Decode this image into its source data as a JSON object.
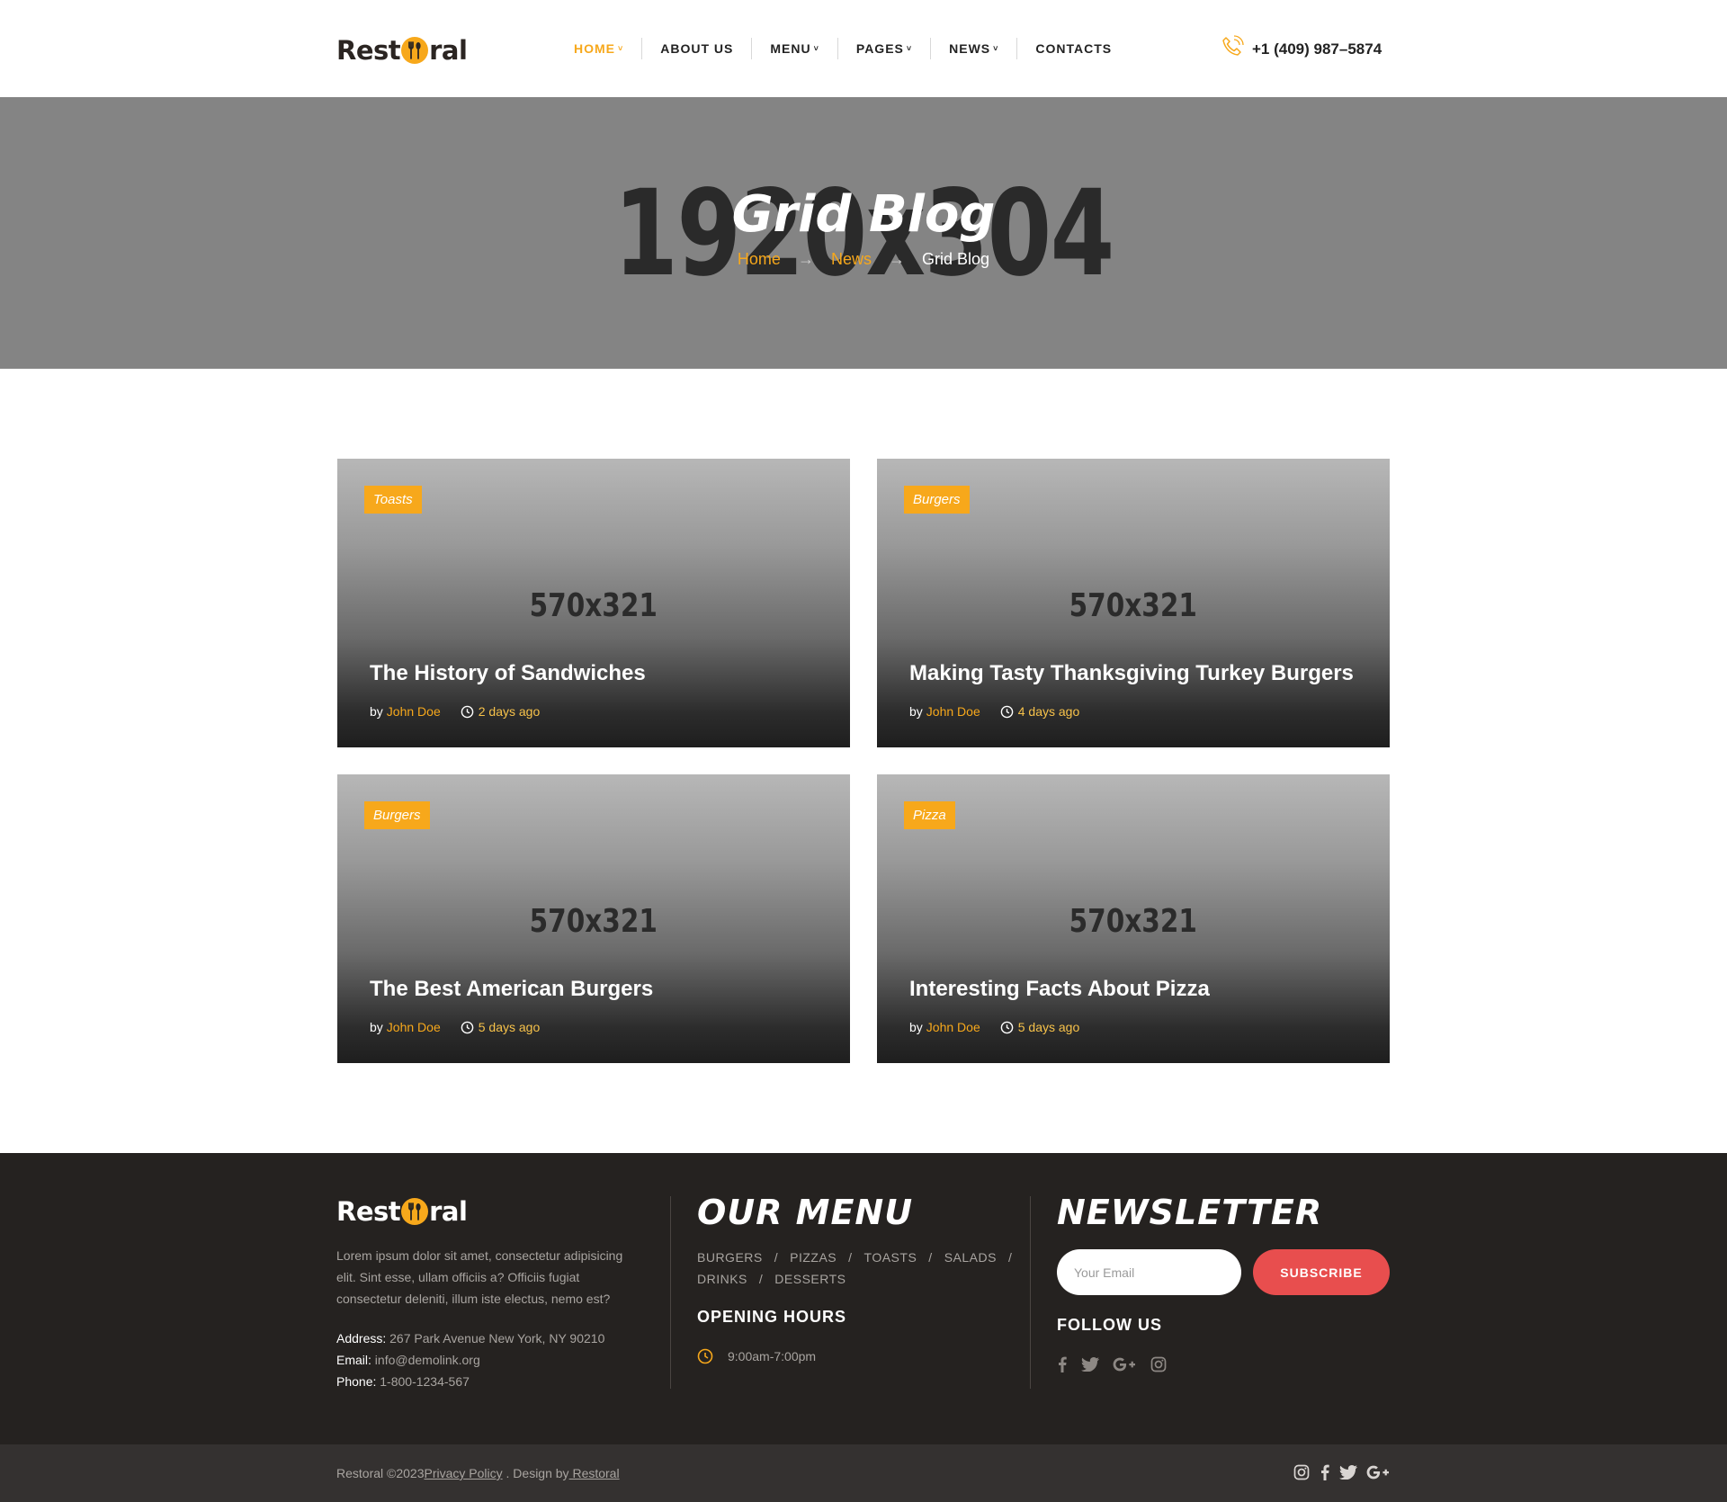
{
  "brand": {
    "logo_left": "Rest",
    "logo_right": "ral",
    "accent": "#f7a81b",
    "accent_red": "#e84e4e"
  },
  "nav": {
    "items": [
      {
        "label": "HOME",
        "dropdown": true,
        "active": true
      },
      {
        "label": "ABOUT US",
        "dropdown": false,
        "active": false
      },
      {
        "label": "MENU",
        "dropdown": true,
        "active": false
      },
      {
        "label": "PAGES",
        "dropdown": true,
        "active": false
      },
      {
        "label": "NEWS",
        "dropdown": true,
        "active": false
      },
      {
        "label": "CONTACTS",
        "dropdown": false,
        "active": false
      }
    ],
    "phone": "+1 (409) 987–5874",
    "phone_icon": "phone-icon"
  },
  "hero": {
    "placeholder": "1920x304",
    "title": "Grid Blog",
    "breadcrumb": {
      "home": "Home",
      "news": "News",
      "current": "Grid Blog",
      "arrow": "→"
    }
  },
  "posts": [
    {
      "tag": "Toasts",
      "placeholder": "570x321",
      "title": "The History of Sandwiches",
      "by": "by",
      "author": "John Doe",
      "time": "2 days ago"
    },
    {
      "tag": "Burgers",
      "placeholder": "570x321",
      "title": "Making Tasty Thanksgiving Turkey Burgers",
      "by": "by",
      "author": "John Doe",
      "time": "4 days ago"
    },
    {
      "tag": "Burgers",
      "placeholder": "570x321",
      "title": "The Best American Burgers",
      "by": "by",
      "author": "John Doe",
      "time": "5 days ago"
    },
    {
      "tag": "Pizza",
      "placeholder": "570x321",
      "title": "Interesting Facts About Pizza",
      "by": "by",
      "author": "John Doe",
      "time": "5 days ago"
    }
  ],
  "footer": {
    "about": "Lorem ipsum dolor sit amet, consectetur adipisicing elit. Sint esse, ullam officiis a? Officiis fugiat consectetur deleniti, illum iste electus, nemo est?",
    "address_label": "Address:",
    "address": "267 Park Avenue New York, NY 90210",
    "email_label": "Email:",
    "email": "info@demolink.org",
    "phone_label": "Phone:",
    "phone": "1-800-1234-567",
    "menu_heading": "OUR MENU",
    "menu_links": [
      "BURGERS",
      "PIZZAS",
      "TOASTS",
      "SALADS",
      "DRINKS",
      "DESSERTS"
    ],
    "menu_sep": "/",
    "hours_heading": "OPENING HOURS",
    "hours": "9:00am-7:00pm",
    "newsletter_heading": "NEWSLETTER",
    "email_placeholder": "Your Email",
    "subscribe_label": "SUBSCRIBE",
    "follow_heading": "FOLLOW US",
    "follow_icons": [
      "facebook-icon",
      "twitter-icon",
      "google-plus-icon",
      "instagram-icon"
    ]
  },
  "bottom": {
    "copyright": "Restoral ©2023",
    "privacy": "Privacy Policy",
    "design_by": " . Design by",
    "design_link": " Restoral",
    "social_icons": [
      "instagram-icon",
      "facebook-icon",
      "twitter-icon",
      "google-plus-icon"
    ]
  }
}
